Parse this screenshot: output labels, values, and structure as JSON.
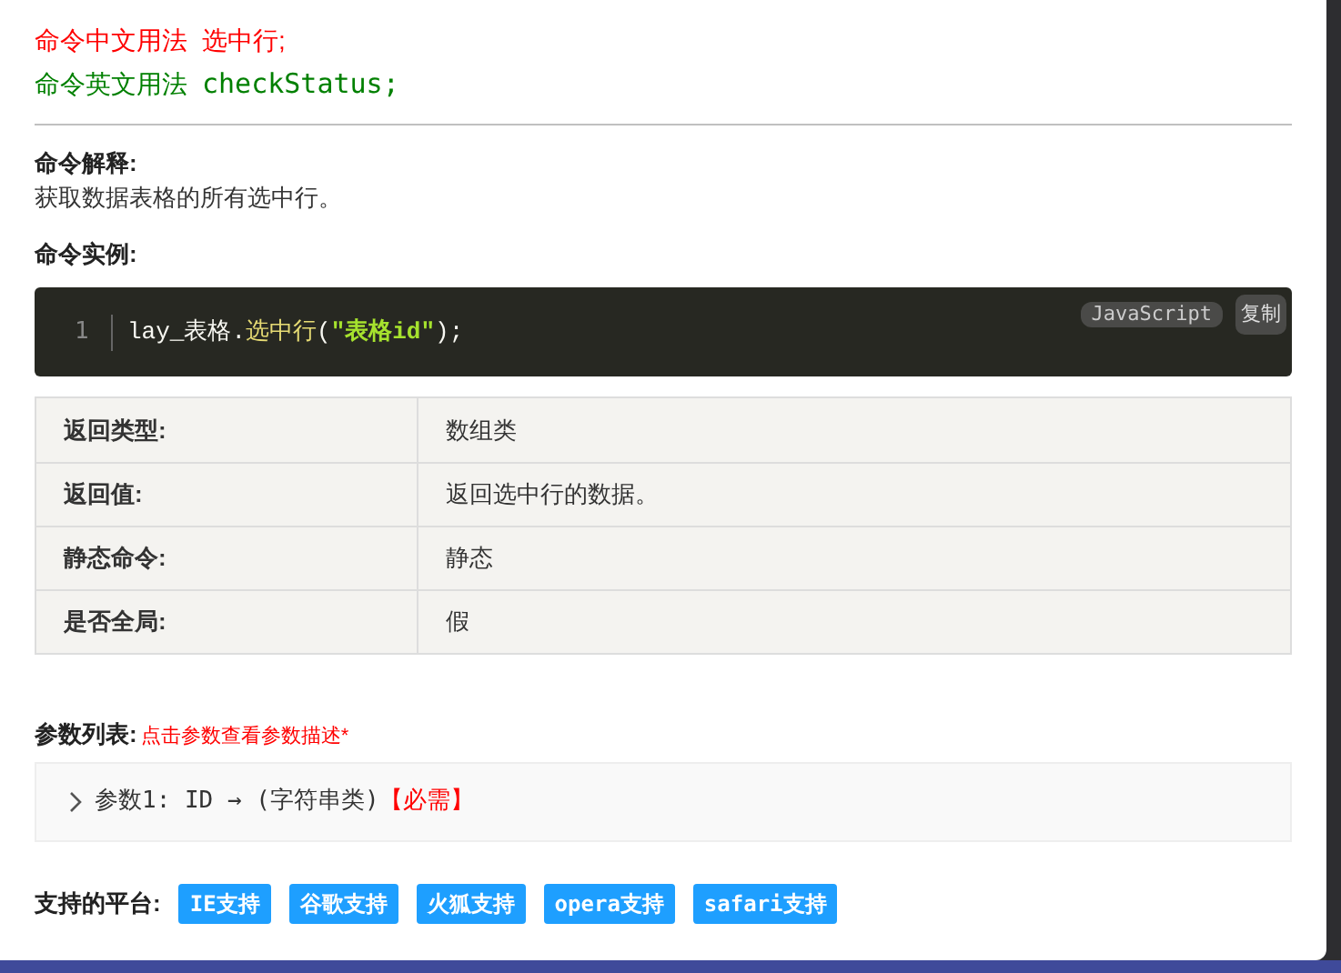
{
  "usage": [
    {
      "kind": "cn",
      "label": "命令中文用法",
      "value": "选中行;"
    },
    {
      "kind": "en",
      "label": "命令英文用法",
      "value": "checkStatus;"
    }
  ],
  "explain": {
    "title": "命令解释:",
    "text": "获取数据表格的所有选中行。"
  },
  "example": {
    "title": "命令实例:",
    "line_number": "1",
    "tokens": [
      {
        "kind": "plain",
        "text": "lay_表格."
      },
      {
        "kind": "func",
        "text": "选中行"
      },
      {
        "kind": "plain",
        "text": "("
      },
      {
        "kind": "string",
        "text": "\"表格id\""
      },
      {
        "kind": "plain",
        "text": ");"
      }
    ],
    "language": "JavaScript",
    "copy": "复制"
  },
  "table": {
    "rows": [
      {
        "label": "返回类型:",
        "value": "数组类"
      },
      {
        "label": "返回值:",
        "value": "返回选中行的数据。"
      },
      {
        "label": "静态命令:",
        "value": "静态"
      },
      {
        "label": "是否全局:",
        "value": "假"
      }
    ]
  },
  "params": {
    "title": "参数列表:",
    "hint": "点击参数查看参数描述*",
    "items": [
      {
        "text": "参数1: ID → (字符串类)",
        "required": "【必需】",
        "expanded": false
      }
    ]
  },
  "platforms": {
    "title": "支持的平台:",
    "items": [
      "IE支持",
      "谷歌支持",
      "火狐支持",
      "opera支持",
      "safari支持"
    ]
  }
}
